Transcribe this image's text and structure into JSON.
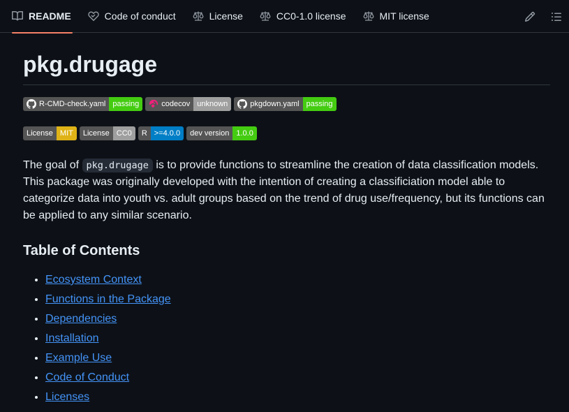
{
  "tabs": [
    {
      "label": "README",
      "icon": "book-icon",
      "active": true
    },
    {
      "label": "Code of conduct",
      "icon": "heart-handshake-icon"
    },
    {
      "label": "License",
      "icon": "scale-icon"
    },
    {
      "label": "CC0-1.0 license",
      "icon": "scale-icon"
    },
    {
      "label": "MIT license",
      "icon": "scale-icon"
    }
  ],
  "actions": [
    {
      "icon": "pencil-icon"
    },
    {
      "icon": "list-icon"
    }
  ],
  "title": "pkg.drugage",
  "badges_row1": [
    {
      "left": "R-CMD-check.yaml",
      "right": "passing",
      "color": "#4c1",
      "icon": "github-icon"
    },
    {
      "left": "codecov",
      "right": "unknown",
      "color": "#9f9f9f",
      "icon": "codecov-icon"
    },
    {
      "left": "pkgdown.yaml",
      "right": "passing",
      "color": "#4c1",
      "icon": "github-icon"
    }
  ],
  "badges_row2": [
    {
      "left": "License",
      "right": "MIT",
      "color": "#dfb317"
    },
    {
      "left": "License",
      "right": "CC0",
      "color": "#9f9f9f"
    },
    {
      "left": "R",
      "right": ">=4.0.0",
      "color": "#007ec6"
    },
    {
      "left": "dev version",
      "right": "1.0.0",
      "color": "#4c1"
    }
  ],
  "description": {
    "before": "The goal of ",
    "code": "pkg.drugage",
    "after": " is to provide functions to streamline the creation of data classification models. This package was originally developed with the intention of creating a classificiation model able to categorize data into youth vs. adult groups based on the trend of drug use/frequency, but its functions can be applied to any similar scenario."
  },
  "toc_heading": "Table of Contents",
  "toc": [
    "Ecosystem Context",
    "Functions in the Package",
    "Dependencies",
    "Installation",
    "Example Use",
    "Code of Conduct",
    "Licenses"
  ]
}
